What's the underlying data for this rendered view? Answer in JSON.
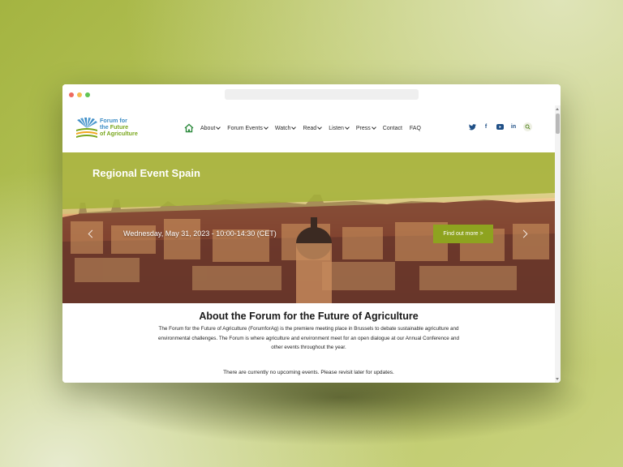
{
  "site": {
    "logo": {
      "line1": "Forum for",
      "line2_a": "the ",
      "line2_b": "Future",
      "line3": "of Agriculture",
      "colors": {
        "blue": "#3f8ec6",
        "green": "#7aa71d"
      }
    },
    "nav": {
      "home_icon": "home-icon",
      "items": [
        {
          "label": "About",
          "has_dropdown": true
        },
        {
          "label": "Forum Events",
          "has_dropdown": true
        },
        {
          "label": "Watch",
          "has_dropdown": true
        },
        {
          "label": "Read",
          "has_dropdown": true
        },
        {
          "label": "Listen",
          "has_dropdown": true
        },
        {
          "label": "Press",
          "has_dropdown": true
        },
        {
          "label": "Contact",
          "has_dropdown": false
        },
        {
          "label": "FAQ",
          "has_dropdown": false
        }
      ]
    },
    "social": {
      "icons": [
        "twitter-icon",
        "facebook-icon",
        "youtube-icon",
        "linkedin-icon",
        "search-icon"
      ],
      "linkedin_text": "in",
      "facebook_text": "f"
    },
    "hero": {
      "title": "Regional Event Spain",
      "date": "Wednesday, May 31, 2023 - 10:00-14:30 (CET)",
      "button": "Find out more >",
      "accent": "#8ea31f"
    },
    "about": {
      "title": "About the Forum for the Future of Agriculture",
      "text": "The Forum for the Future of Agriculture (ForumforAg) is the premiere meeting place in Brussels to debate sustainable agriculture and environmental challenges. The Forum is where agriculture and environment meet for an open dialogue at our Annual Conference and other events throughout the year."
    },
    "events": {
      "message": "There are currently no upcoming events. Please revisit later for updates."
    }
  }
}
